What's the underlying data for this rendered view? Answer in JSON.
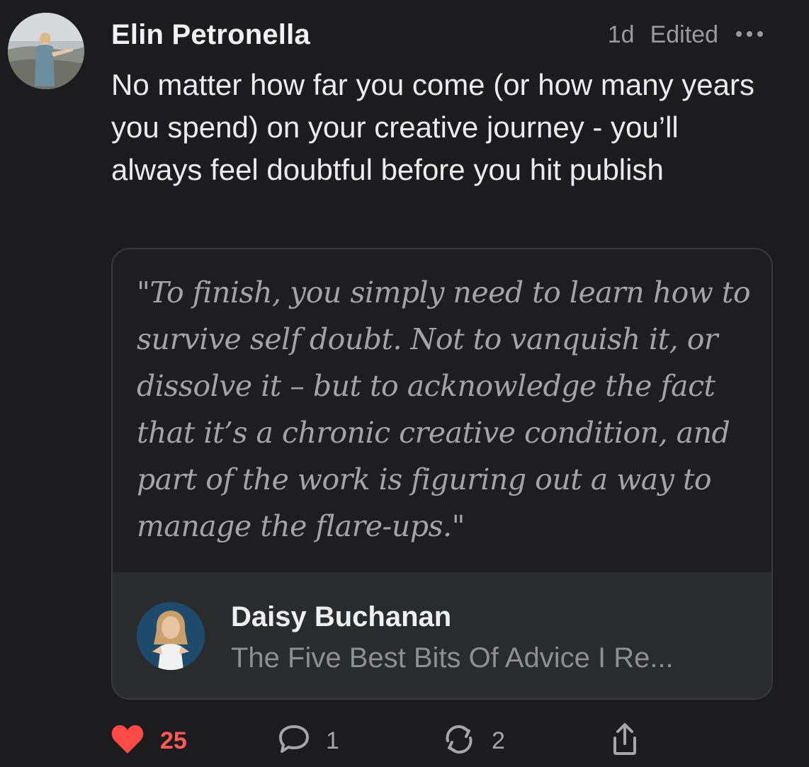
{
  "post": {
    "author": "Elin Petronella",
    "time": "1d",
    "edited_label": "Edited",
    "more_icon": "ellipsis-icon",
    "body": "No matter how far you come (or how many years you spend) on your creative journey - you’ll always feel doubtful before you hit publish"
  },
  "quote": {
    "text": "\"To finish, you simply need to learn how to survive self doubt. Not to vanquish it, or dissolve it – but to acknowledge the fact that it’s a chronic creative condition, and part of the work is figuring out a way to manage the flare-ups.\"",
    "source_author": "Daisy Buchanan",
    "source_title": "The Five Best Bits Of Advice I Re..."
  },
  "actions": {
    "likes": "25",
    "comments": "1",
    "restacks": "2",
    "like_icon": "heart-icon",
    "comment_icon": "speech-bubble-icon",
    "restack_icon": "restack-arrows-icon",
    "share_icon": "share-icon"
  },
  "colors": {
    "background": "#1c1c1e",
    "like_red": "#ff4b47",
    "muted": "#9a9a9f",
    "card_footer": "#2a2b2d"
  }
}
